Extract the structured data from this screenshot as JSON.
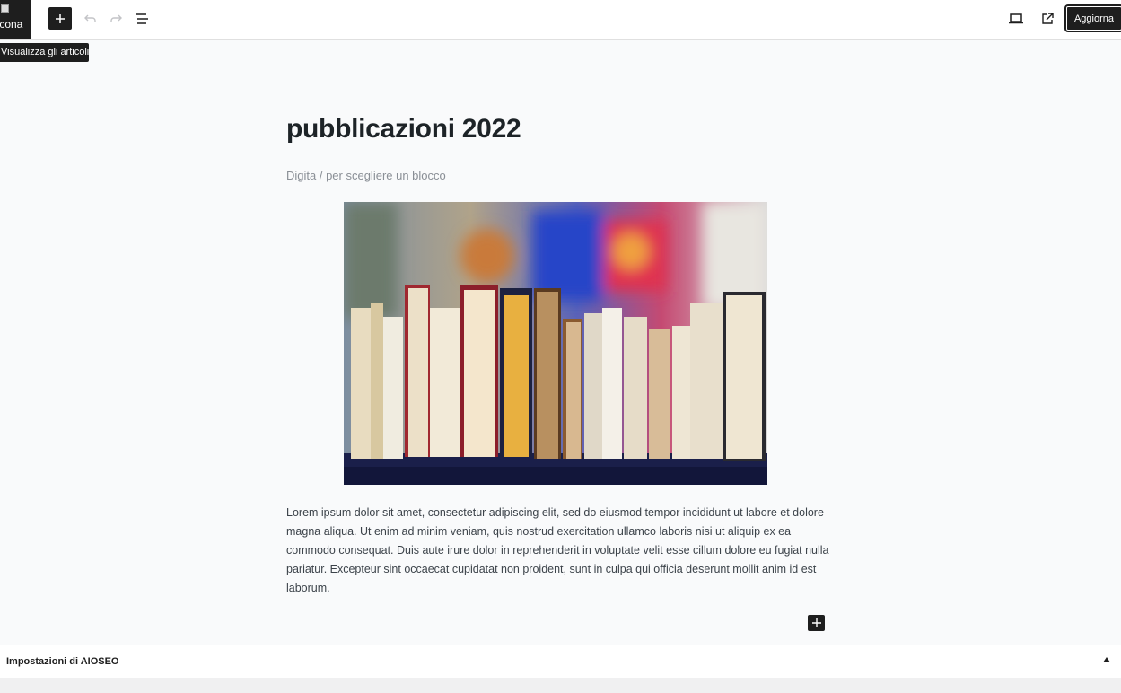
{
  "toolbar": {
    "site_icon_alt": "Icona",
    "update_label": "Aggiorna"
  },
  "tooltip": {
    "text": "Visualizza gli articoli"
  },
  "editor": {
    "title": "pubblicazioni 2022",
    "placeholder": "Digita / per scegliere un blocco",
    "paragraph": "Lorem ipsum dolor sit amet, consectetur adipiscing elit, sed do eiusmod tempor incididunt ut labore et dolore magna aliqua. Ut enim ad minim veniam, quis nostrud exercitation ullamco laboris nisi ut aliquip ex ea commodo consequat. Duis aute irure dolor in reprehenderit in voluptate velit esse cillum dolore eu fugiat nulla pariatur. Excepteur sint occaecat cupidatat non proident, sunt in culpa qui officia deserunt mollit anim id est laborum."
  },
  "seo": {
    "title": "Impostazioni di AIOSEO"
  },
  "colors": {
    "dark": "#1e1e1e",
    "accent": "#2271b1"
  }
}
